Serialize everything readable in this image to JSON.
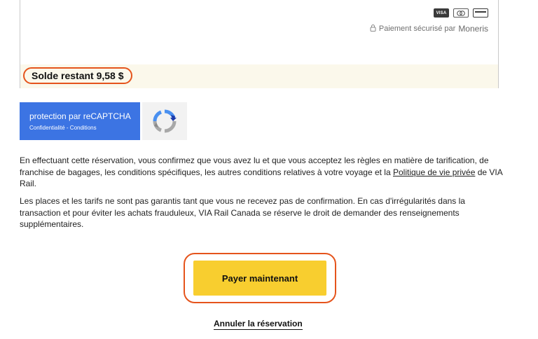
{
  "payment": {
    "cards": [
      "VISA",
      "mastercard",
      "card"
    ],
    "lock_icon": "lock-icon",
    "secure_text": "Paiement sécurisé par",
    "secure_brand": "Moneris"
  },
  "balance": {
    "label": "Solde restant 9,58 $"
  },
  "recaptcha": {
    "title": "protection par reCAPTCHA",
    "links": "Confidentialité - Conditions",
    "logo_icon": "recaptcha-logo-icon"
  },
  "terms": {
    "part1": "En effectuant cette réservation, vous confirmez que vous avez lu et que vous acceptez les règles en matière de tarification, de franchise de bagages, les conditions spécifiques, les autres conditions relatives à votre voyage et la ",
    "policy_link": "Politique de vie privée",
    "part2": " de VIA Rail."
  },
  "notice": {
    "text": "Les places et les tarifs ne sont pas garantis tant que vous ne recevez pas de confirmation. En cas d'irrégularités dans la transaction et pour éviter les achats frauduleux, VIA Rail Canada se réserve le droit de demander des renseignements supplémentaires."
  },
  "actions": {
    "pay_label": "Payer maintenant",
    "cancel_label": "Annuler la réservation"
  },
  "colors": {
    "highlight": "#e5541c",
    "pay_button": "#f8ce2f",
    "recaptcha_blue": "#3c74e3",
    "balance_band": "#fbf8eb"
  }
}
